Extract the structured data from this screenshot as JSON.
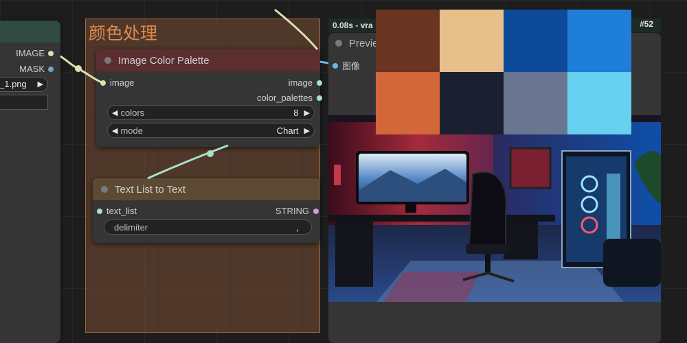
{
  "load_node": {
    "outputs": [
      {
        "label": "IMAGE",
        "color": "#d9e3b4"
      },
      {
        "label": "MASK",
        "color": "#6fa3c8"
      }
    ],
    "file_value": "_1.png"
  },
  "group": {
    "title": "颜色处理"
  },
  "palette_node": {
    "title": "Image Color Palette",
    "input_label": "image",
    "outputs": [
      "image",
      "color_palettes"
    ],
    "widgets": [
      {
        "label": "colors",
        "value": "8"
      },
      {
        "label": "mode",
        "value": "Chart"
      }
    ]
  },
  "textlist_node": {
    "title": "Text List to Text",
    "input_label": "text_list",
    "output_label": "STRING",
    "delimiter_label": "delimiter",
    "delimiter_value": ","
  },
  "preview_node": {
    "timing": "0.08s - vra",
    "node_id": "#52",
    "title": "Previe",
    "input_label": "图像"
  },
  "palette_colors": [
    "#6a3422",
    "#e6c08a",
    "#0e4a9a",
    "#1f7ed8",
    "#d4673a",
    "#1a2030",
    "#6a7592",
    "#66d0ee"
  ],
  "icons": {
    "arrow_left": "◀",
    "arrow_right": "▶"
  },
  "colors": {
    "group_border": "#a3663b",
    "wire": "#a8e0c8",
    "palette_header": "#5b2f2f",
    "textlist_header": "#5d4a32"
  }
}
